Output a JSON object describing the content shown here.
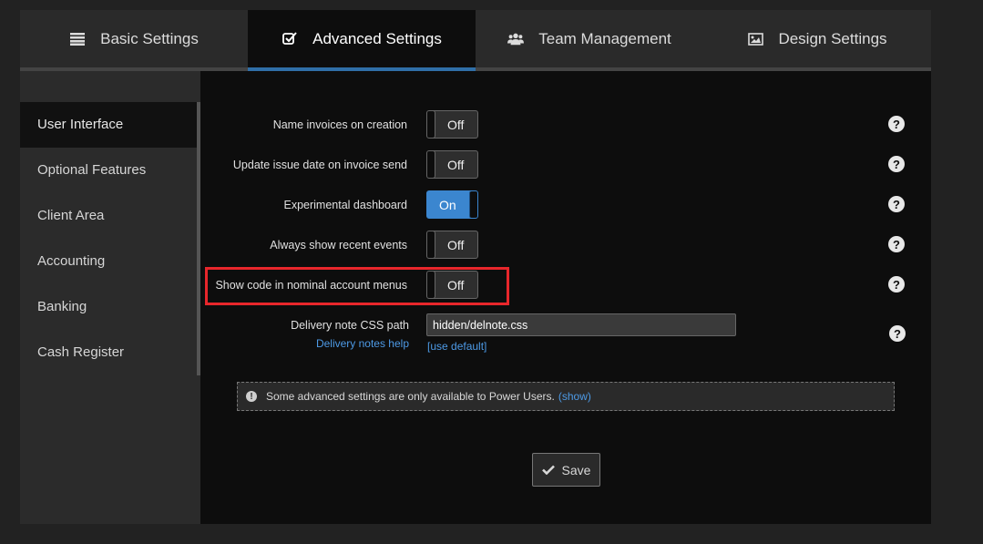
{
  "tabs": [
    {
      "label": "Basic Settings",
      "icon": "list-icon",
      "active": false
    },
    {
      "label": "Advanced Settings",
      "icon": "checkbox-icon",
      "active": true
    },
    {
      "label": "Team Management",
      "icon": "users-icon",
      "active": false
    },
    {
      "label": "Design Settings",
      "icon": "image-icon",
      "active": false
    }
  ],
  "sidebar": {
    "items": [
      {
        "label": "User Interface",
        "active": true
      },
      {
        "label": "Optional Features"
      },
      {
        "label": "Client Area"
      },
      {
        "label": "Accounting"
      },
      {
        "label": "Banking"
      },
      {
        "label": "Cash Register"
      }
    ]
  },
  "settings": [
    {
      "label": "Name invoices on creation",
      "state": "Off"
    },
    {
      "label": "Update issue date on invoice send",
      "state": "Off"
    },
    {
      "label": "Experimental dashboard",
      "state": "On"
    },
    {
      "label": "Always show recent events",
      "state": "Off"
    },
    {
      "label": "Show code in nominal account menus",
      "state": "Off"
    }
  ],
  "delivery_note": {
    "label": "Delivery note CSS path",
    "help_link": "Delivery notes help",
    "value": "hidden/delnote.css",
    "use_default": "[use default]"
  },
  "help_glyph": "?",
  "notice": {
    "text": "Some advanced settings are only available to Power Users.",
    "link": "(show)"
  },
  "save_label": "Save",
  "colors": {
    "accent": "#3b86cf",
    "highlight": "#e8262b",
    "link": "#4d9ae6"
  }
}
